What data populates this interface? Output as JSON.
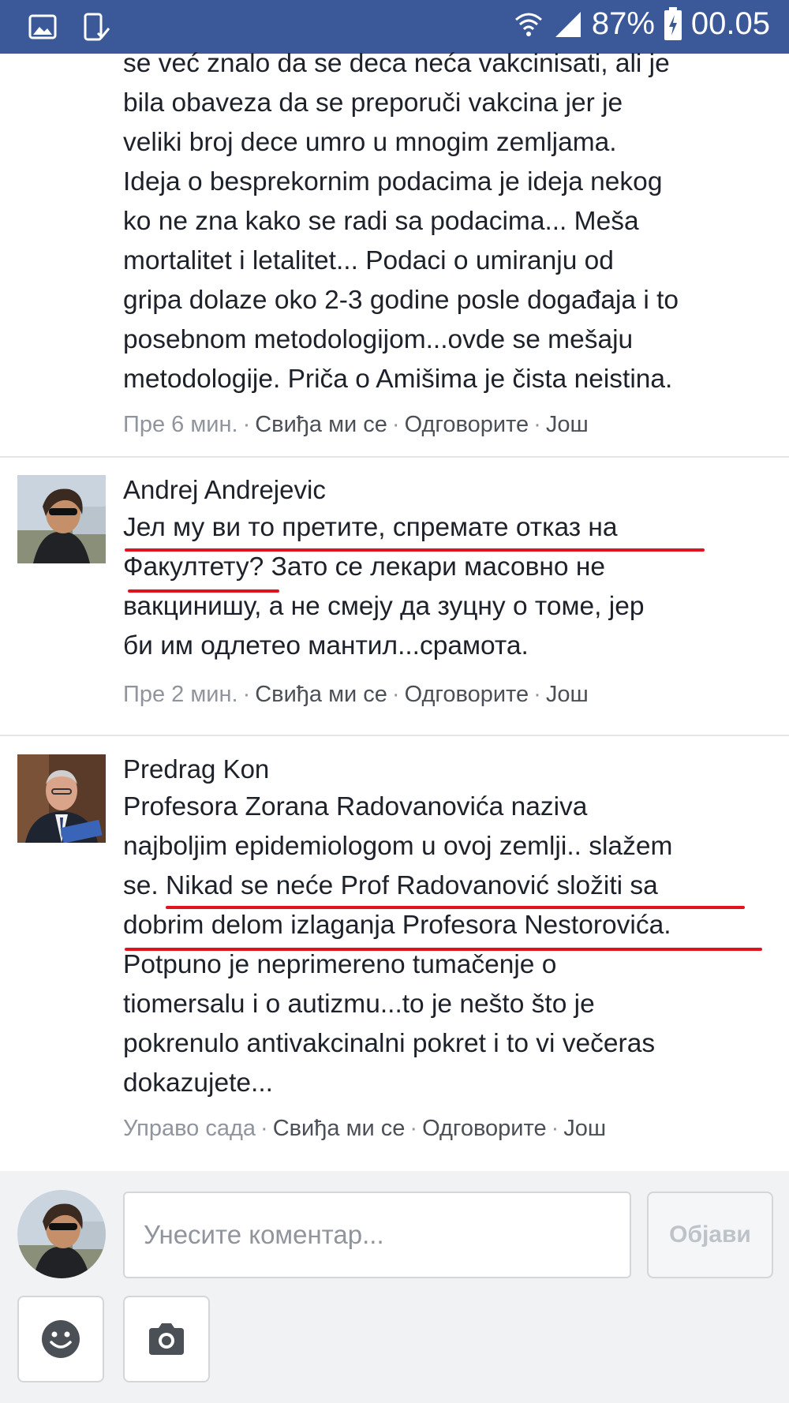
{
  "status_bar": {
    "battery": "87%",
    "time": "00.05",
    "bg_color": "#3b5998"
  },
  "comments": [
    {
      "author": "",
      "lines": [
        "se već znalo da se deca neća vakcinisati, ali je",
        "bila obaveza da se preporuči vakcina jer je",
        "veliki broj dece umro u mnogim zemljama.",
        "Ideja o besprekornim podacima je ideja nekog",
        "ko ne zna kako se radi sa podacima... Meša",
        "mortalitet i letalitet... Podaci o umiranju od",
        "gripa dolaze oko 2-3 godine posle događaja i to",
        "posebnom metodologijom...ovde se mešaju",
        "metodologije. Priča o Amišima je čista neistina."
      ],
      "time": "Пре 6 мин.",
      "like": "Свиђа ми се",
      "reply": "Одговорите",
      "more": "Још"
    },
    {
      "author": "Andrej Andrejevic",
      "lines": [
        "Јел му ви то претите, спремате отказ на",
        "Факултету? Зато се лекари масовно не",
        "вакцинишу, а не смеју да зуцну о томе, јер",
        "би им одлетео мантил...срамота."
      ],
      "time": "Пре 2 мин.",
      "like": "Свиђа ми се",
      "reply": "Одговорите",
      "more": "Још"
    },
    {
      "author": "Predrag Kon",
      "lines": [
        "Profesora Zorana Radovanovića naziva",
        "najboljim epidemiologom u ovoj zemlji.. slažem",
        "se. Nikad se neće Prof Radovanović složiti sa",
        "dobrim delom izlaganja Profesora Nestorovića.",
        "Potpuno je neprimereno tumačenje o",
        "tiomersalu i o autizmu...to je nešto što je",
        "pokrenulo antivakcinalni pokret i to vi večeras",
        "dokazujete..."
      ],
      "time": "Управо сада",
      "like": "Свиђа ми се",
      "reply": "Одговорите",
      "more": "Још"
    }
  ],
  "composer": {
    "placeholder": "Унесите коментар...",
    "post_label": "Објави"
  },
  "icons": {
    "status_left": [
      "image-icon",
      "phone-check-icon"
    ],
    "status_right": [
      "wifi-icon",
      "signal-icon",
      "battery-charging-icon"
    ],
    "tools": [
      "emoji-icon",
      "camera-icon"
    ]
  },
  "colors": {
    "highlight_underline": "#e0141e",
    "meta_text": "#90949c"
  }
}
